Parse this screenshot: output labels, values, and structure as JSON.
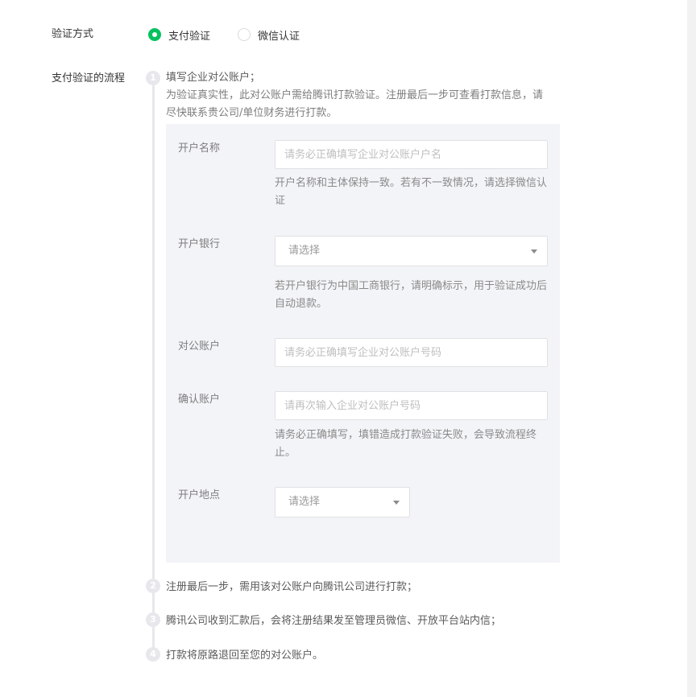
{
  "verify": {
    "label": "验证方式",
    "options": [
      {
        "label": "支付验证",
        "checked": true
      },
      {
        "label": "微信认证",
        "checked": false
      }
    ]
  },
  "flow": {
    "label": "支付验证的流程",
    "steps": [
      {
        "num": "1",
        "title": "填写企业对公账户；",
        "desc": "为验证真实性，此对公账户需给腾讯打款验证。注册最后一步可查看打款信息，请尽快联系贵公司/单位财务进行打款。"
      },
      {
        "num": "2",
        "title": "注册最后一步，需用该对公账户向腾讯公司进行打款；"
      },
      {
        "num": "3",
        "title": "腾讯公司收到汇款后，会将注册结果发至管理员微信、开放平台站内信；"
      },
      {
        "num": "4",
        "title": "打款将原路退回至您的对公账户。"
      }
    ]
  },
  "form": {
    "account_name": {
      "label": "开户名称",
      "placeholder": "请务必正确填写企业对公账户户名",
      "hint": "开户名称和主体保持一致。若有不一致情况，请选择微信认证"
    },
    "bank": {
      "label": "开户银行",
      "value": "请选择",
      "hint": "若开户银行为中国工商银行，请明确标示，用于验证成功后自动退款。"
    },
    "account_no": {
      "label": "对公账户",
      "placeholder": "请务必正确填写企业对公账户号码"
    },
    "confirm_no": {
      "label": "确认账户",
      "placeholder": "请再次输入企业对公账户号码",
      "hint": "请务必正确填写，填错造成打款验证失败，会导致流程终止。"
    },
    "location": {
      "label": "开户地点",
      "value": "请选择"
    }
  },
  "colors": {
    "accent": "#07c160"
  }
}
